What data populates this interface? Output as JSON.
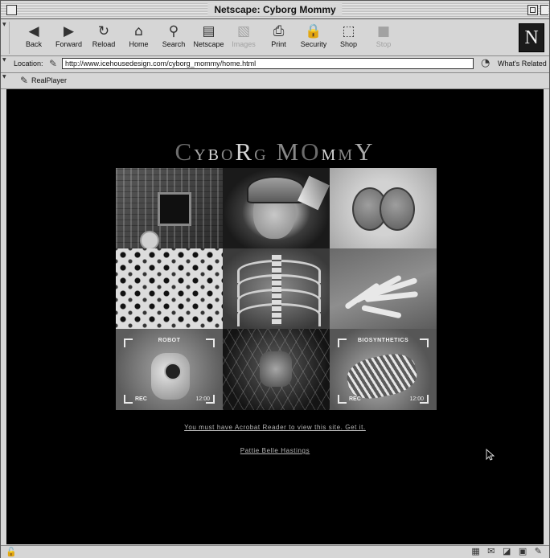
{
  "window": {
    "title": "Netscape: Cyborg Mommy"
  },
  "toolbar": {
    "buttons": [
      {
        "label": "Back",
        "icon": "back-icon",
        "enabled": true
      },
      {
        "label": "Forward",
        "icon": "forward-icon",
        "enabled": true
      },
      {
        "label": "Reload",
        "icon": "reload-icon",
        "enabled": true
      },
      {
        "label": "Home",
        "icon": "home-icon",
        "enabled": true
      },
      {
        "label": "Search",
        "icon": "search-icon",
        "enabled": true
      },
      {
        "label": "Netscape",
        "icon": "netscape-icon",
        "enabled": true
      },
      {
        "label": "Images",
        "icon": "images-icon",
        "enabled": false
      },
      {
        "label": "Print",
        "icon": "print-icon",
        "enabled": true
      },
      {
        "label": "Security",
        "icon": "security-icon",
        "enabled": true
      },
      {
        "label": "Shop",
        "icon": "shop-icon",
        "enabled": true
      },
      {
        "label": "Stop",
        "icon": "stop-icon",
        "enabled": false
      }
    ],
    "logo_letter": "N"
  },
  "location": {
    "label": "Location:",
    "url": "http://www.icehousedesign.com/cyborg_mommy/home.html",
    "related_label": "What's Related"
  },
  "personal": {
    "realplayer_label": "RealPlayer"
  },
  "page": {
    "title_letters": [
      {
        "ch": "C",
        "tone": "c1",
        "size": "big"
      },
      {
        "ch": "Y",
        "tone": "c2",
        "size": "sm"
      },
      {
        "ch": "B",
        "tone": "c3",
        "size": "sm"
      },
      {
        "ch": "O",
        "tone": "c4",
        "size": "sm"
      },
      {
        "ch": "R",
        "tone": "c3",
        "size": "big"
      },
      {
        "ch": "G",
        "tone": "c4",
        "size": "sm"
      },
      {
        "ch": " ",
        "tone": "c1",
        "size": "sm"
      },
      {
        "ch": "M",
        "tone": "c4",
        "size": "big"
      },
      {
        "ch": "O",
        "tone": "c1",
        "size": "big"
      },
      {
        "ch": "M",
        "tone": "c3",
        "size": "sm"
      },
      {
        "ch": "M",
        "tone": "c4",
        "size": "sm"
      },
      {
        "ch": "Y",
        "tone": "c2",
        "size": "big"
      }
    ],
    "tiles": [
      {
        "name": "circuit-board-tile"
      },
      {
        "name": "helmet-face-tile"
      },
      {
        "name": "cell-division-tile"
      },
      {
        "name": "microscope-dots-tile"
      },
      {
        "name": "rib-cage-tile"
      },
      {
        "name": "xray-hand-tile"
      },
      {
        "name": "robot-camera-tile",
        "label": "ROBOT",
        "rec": "REC",
        "time": "12:00"
      },
      {
        "name": "wired-face-tile"
      },
      {
        "name": "biosynthetic-tile",
        "label": "BIOSYNTHETICS",
        "rec": "REC",
        "time": "12:00"
      }
    ],
    "acrobat_link": "You must have Acrobat Reader to view this site. Get it.",
    "author_link": "Pattie Belle Hastings"
  }
}
